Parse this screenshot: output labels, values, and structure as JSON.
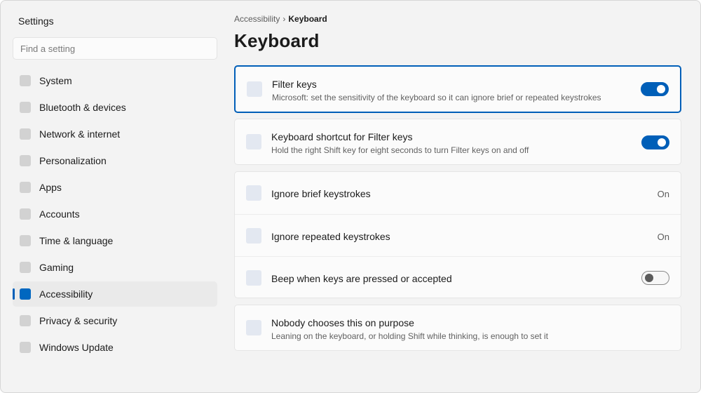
{
  "app": {
    "title": "Settings"
  },
  "search": {
    "placeholder": "Find a setting"
  },
  "sidebar": {
    "items": [
      {
        "label": "System",
        "icon": "system-icon",
        "active": false
      },
      {
        "label": "Bluetooth & devices",
        "icon": "bluetooth-icon",
        "active": false
      },
      {
        "label": "Network & internet",
        "icon": "network-icon",
        "active": false
      },
      {
        "label": "Personalization",
        "icon": "personalization-icon",
        "active": false
      },
      {
        "label": "Apps",
        "icon": "apps-icon",
        "active": false
      },
      {
        "label": "Accounts",
        "icon": "accounts-icon",
        "active": false
      },
      {
        "label": "Time & language",
        "icon": "time-language-icon",
        "active": false
      },
      {
        "label": "Gaming",
        "icon": "gaming-icon",
        "active": false
      },
      {
        "label": "Accessibility",
        "icon": "accessibility-icon",
        "active": true
      },
      {
        "label": "Privacy & security",
        "icon": "shield-icon",
        "active": false
      },
      {
        "label": "Windows Update",
        "icon": "update-icon",
        "active": false
      }
    ]
  },
  "breadcrumb": {
    "parent": "Accessibility",
    "separator": "›",
    "current": "Keyboard"
  },
  "page": {
    "title": "Keyboard"
  },
  "settings": {
    "filter_keys": {
      "title": "Filter keys",
      "description": "Microsoft: set the sensitivity of the keyboard so it can ignore brief or repeated keystrokes",
      "toggle": "on"
    },
    "shortcut": {
      "title": "Keyboard shortcut for Filter keys",
      "description": "Hold the right Shift key for eight seconds to turn Filter keys on and off",
      "toggle": "on"
    },
    "ignore_brief": {
      "title": "Ignore brief keystrokes",
      "value": "On"
    },
    "ignore_repeated": {
      "title": "Ignore repeated keystrokes",
      "value": "On"
    },
    "beep": {
      "title": "Beep when keys are pressed or accepted",
      "toggle": "off"
    },
    "nobody": {
      "title": "Nobody chooses this on purpose",
      "description": "Leaning on the keyboard, or holding Shift while thinking, is enough to set it"
    }
  },
  "colors": {
    "accent": "#005fb8",
    "window_bg": "#f3f3f3",
    "card_bg": "#fbfbfb",
    "placeholder_icon": "#e3e8f1"
  }
}
